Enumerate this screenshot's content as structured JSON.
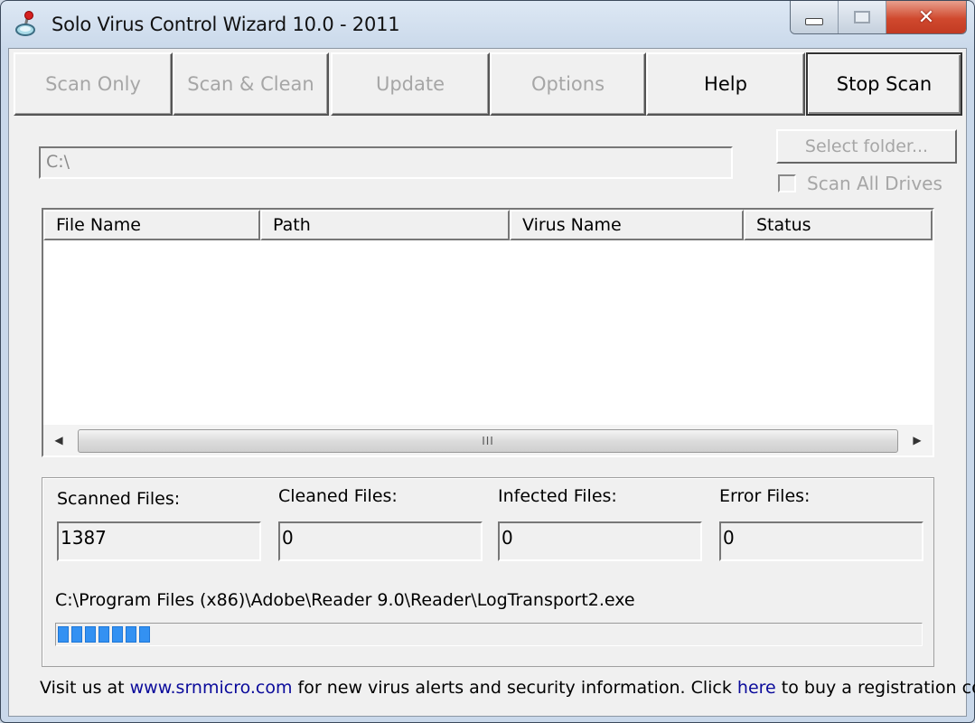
{
  "window": {
    "title": "Solo Virus Control Wizard 10.0 - 2011",
    "controls": [
      "minimize",
      "maximize",
      "close"
    ]
  },
  "toolbar": {
    "buttons": [
      {
        "label": "Scan Only",
        "enabled": false
      },
      {
        "label": "Scan & Clean",
        "enabled": false
      },
      {
        "label": "Update",
        "enabled": false
      },
      {
        "label": "Options",
        "enabled": false
      },
      {
        "label": "Help",
        "enabled": true
      },
      {
        "label": "Stop Scan",
        "enabled": true,
        "default": true
      }
    ]
  },
  "scan_target": {
    "path_value": "C:\\",
    "select_folder_label": "Select folder...",
    "scan_all_drives_label": "Scan All Drives",
    "scan_all_drives_checked": false
  },
  "results_table": {
    "columns": [
      "File Name",
      "Path",
      "Virus Name",
      "Status"
    ],
    "rows": [],
    "scrollbar_grip": "III"
  },
  "stats": {
    "scanned": {
      "label": "Scanned Files:",
      "value": "1387"
    },
    "cleaned": {
      "label": "Cleaned Files:",
      "value": "0"
    },
    "infected": {
      "label": "Infected Files:",
      "value": "0"
    },
    "errors": {
      "label": "Error Files:",
      "value": "0"
    }
  },
  "progress": {
    "current_file": "C:\\Program Files (x86)\\Adobe\\Reader 9.0\\Reader\\LogTransport2.exe",
    "percent": 11,
    "color": "#3391f2"
  },
  "footer": {
    "text_1": "Visit us at ",
    "link_1": "www.srnmicro.com",
    "text_2": " for new virus alerts and security information. Click ",
    "link_2": "here",
    "text_3": " to buy a registration code.",
    "link_color": "#0b0b9b"
  }
}
